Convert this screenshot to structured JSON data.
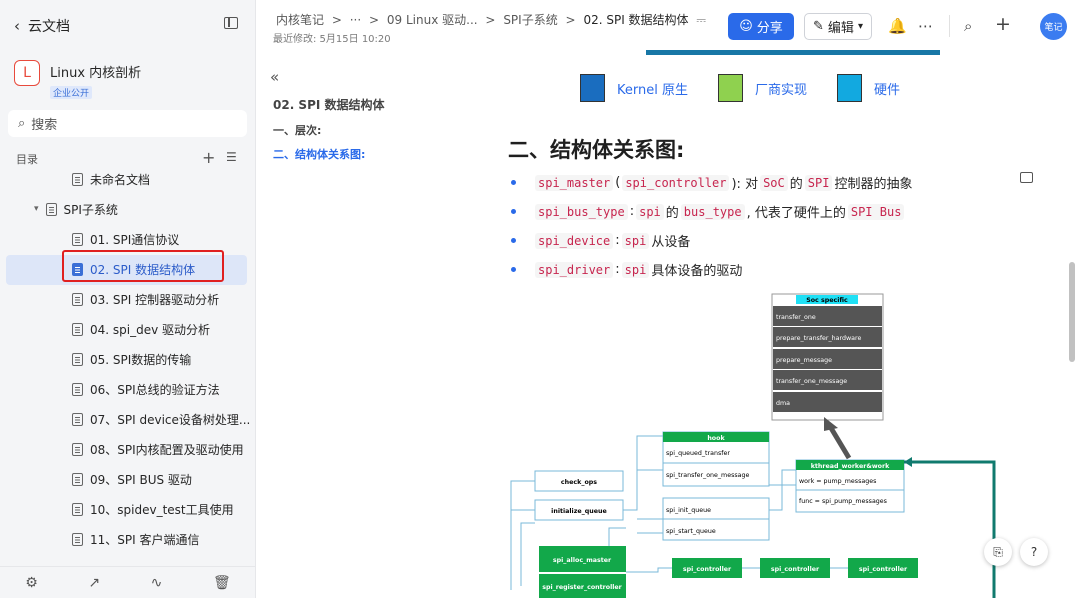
{
  "sidebar": {
    "title": "云文档",
    "kb_logo": "L",
    "kb_name": "Linux 内核剖析",
    "kb_badge": "企业公开",
    "search_placeholder": "搜索",
    "toc_label": "目录",
    "items": [
      {
        "label": "未命名文档"
      },
      {
        "label": "SPI子系统"
      },
      {
        "label": "01. SPI通信协议"
      },
      {
        "label": "02. SPI 数据结构体"
      },
      {
        "label": "03. SPI 控制器驱动分析"
      },
      {
        "label": "04. spi_dev 驱动分析"
      },
      {
        "label": "05. SPI数据的传输"
      },
      {
        "label": "06、SPI总线的验证方法"
      },
      {
        "label": "07、SPI device设备树处理..."
      },
      {
        "label": "08、SPI内核配置及驱动使用"
      },
      {
        "label": "09、SPI BUS 驱动"
      },
      {
        "label": "10、spidev_test工具使用"
      },
      {
        "label": "11、SPI 客户端通信"
      }
    ],
    "footer_icons": [
      "settings-icon",
      "share-icon",
      "stats-icon",
      "trash-icon"
    ]
  },
  "header": {
    "crumbs": [
      "内核笔记",
      ">",
      "···",
      ">",
      "09 Linux 驱动...",
      ">",
      "SPI子系统",
      ">",
      "02. SPI 数据结构体"
    ],
    "modified": "最近修改: 5月15日 10:20",
    "share_label": "分享",
    "edit_label": "编辑",
    "avatar": "笔记"
  },
  "outline": {
    "title": "02. SPI 数据结构体",
    "items": [
      "一、层次:",
      "二、结构体关系图:"
    ]
  },
  "doc": {
    "legend": [
      {
        "label": "Kernel 原生",
        "color": "#1a6dbf"
      },
      {
        "label": "厂商实现",
        "color": "#8fd14f"
      },
      {
        "label": "硬件",
        "color": "#12a9e0"
      }
    ],
    "heading": "二、结构体关系图:",
    "bullets": [
      [
        {
          "c": "spi_master"
        },
        {
          "t": "("
        },
        {
          "c": "spi_controller"
        },
        {
          "t": "): 对"
        },
        {
          "c": "SoC"
        },
        {
          "t": "的"
        },
        {
          "c": "SPI"
        },
        {
          "t": "控制器的抽象"
        }
      ],
      [
        {
          "c": "spi_bus_type"
        },
        {
          "t": ":"
        },
        {
          "c": "spi"
        },
        {
          "t": "的"
        },
        {
          "c": "bus_type"
        },
        {
          "t": ", 代表了硬件上的"
        },
        {
          "c": "SPI Bus"
        }
      ],
      [
        {
          "c": "spi_device"
        },
        {
          "t": ":"
        },
        {
          "c": "spi"
        },
        {
          "t": "从设备"
        }
      ],
      [
        {
          "c": "spi_driver"
        },
        {
          "t": ":"
        },
        {
          "c": "spi"
        },
        {
          "t": "具体设备的驱动"
        }
      ]
    ],
    "diagram": {
      "soc_title": "Soc specific",
      "soc_rows": [
        "transfer_one",
        "prepare_transfer_hardware",
        "prepare_message",
        "transfer_one_message",
        "dma"
      ],
      "hook_title": "hook",
      "hook_rows": [
        "spi_queued_transfer",
        "spi_transfer_one_message"
      ],
      "kthread_title": "kthread_worker&work",
      "kthread_rows": [
        "work = pump_messages",
        "func = spi_pump_messages"
      ],
      "check_ops": "check_ops",
      "initialize_queue": "initialize_queue",
      "init_rows": [
        "spi_init_queue",
        "spi_start_queue"
      ],
      "alloc_master": "spi_alloc_master",
      "register_controller": "spi_register_controller",
      "controllers": [
        "spi_controller",
        "spi_controller",
        "spi_controller"
      ]
    }
  }
}
